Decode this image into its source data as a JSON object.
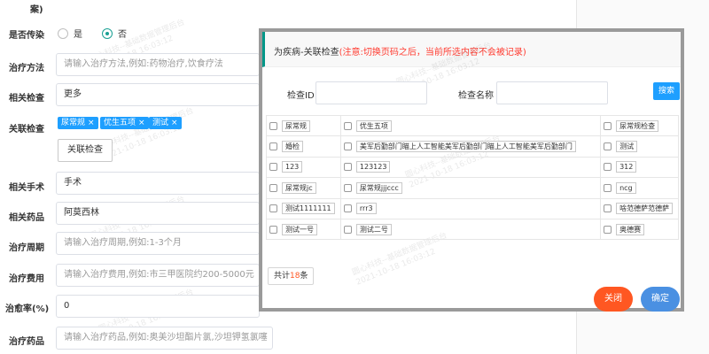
{
  "form": {
    "top_fragment": "案)",
    "infectious": {
      "label": "是否传染",
      "option_yes": "是",
      "option_no": "否",
      "selected": "否"
    },
    "treatment_method": {
      "label": "治疗方法",
      "placeholder": "请输入治疗方法,例如:药物治疗,饮食疗法"
    },
    "related_check": {
      "label": "相关检查",
      "value": "更多"
    },
    "linked_check": {
      "label": "关联检查",
      "tags": [
        {
          "label": "尿常规"
        },
        {
          "label": "优生五项"
        },
        {
          "label": "测试"
        }
      ],
      "tag_remove_glyph": "×",
      "button_label": "关联检查"
    },
    "related_surgery": {
      "label": "相关手术",
      "value": "手术"
    },
    "related_drug": {
      "label": "相关药品",
      "value": "阿莫西林"
    },
    "treatment_cycle": {
      "label": "治疗周期",
      "placeholder": "请输入治疗周期,例如:1-3个月"
    },
    "treatment_cost": {
      "label": "治疗费用",
      "placeholder": "请输入治疗费用,例如:市三甲医院约200-5000元"
    },
    "cure_rate": {
      "label": "治愈率(%)",
      "value": "0"
    },
    "treatment_drug": {
      "label": "治疗药品",
      "placeholder": "请输入治疗药品,例如:奥美沙坦酯片氯,沙坦钾氢氯噻"
    }
  },
  "watermark": {
    "line1": "圆心科技--基础数据管理后台",
    "line2": "2021-10-18 16:03:12"
  },
  "dialog": {
    "title_main": "为疾病-关联检查",
    "title_warning": "(注意:切换页码之后，当前所选内容不会被记录)",
    "filter": {
      "id_label": "检查ID",
      "name_label": "检查名称",
      "search_label": "搜索"
    },
    "rows": [
      [
        "尿常规",
        "优生五项",
        "尿常规检查"
      ],
      [
        "婚检",
        "美军后勤部门瞄上人工智能美军后勤部门瞄上人工智能美军后勤部门",
        "测试"
      ],
      [
        "123",
        "123123",
        "312"
      ],
      [
        "尿常规jc",
        "尿常规jjjccc",
        "ncg"
      ],
      [
        "测试1111111",
        "rrr3",
        "啥范德萨范德萨"
      ],
      [
        "测试一号",
        "测试二号",
        "奥德赛"
      ]
    ],
    "total_prefix": "共计",
    "total_count": "18",
    "total_suffix": "条",
    "close_label": "关闭",
    "confirm_label": "确定"
  },
  "colors": {
    "primary_blue": "#1e9fff",
    "close_orange": "#ff5722",
    "confirm_blue": "#4a90e2",
    "warning_red": "#ff3b30",
    "radio_green": "#1aa094"
  }
}
